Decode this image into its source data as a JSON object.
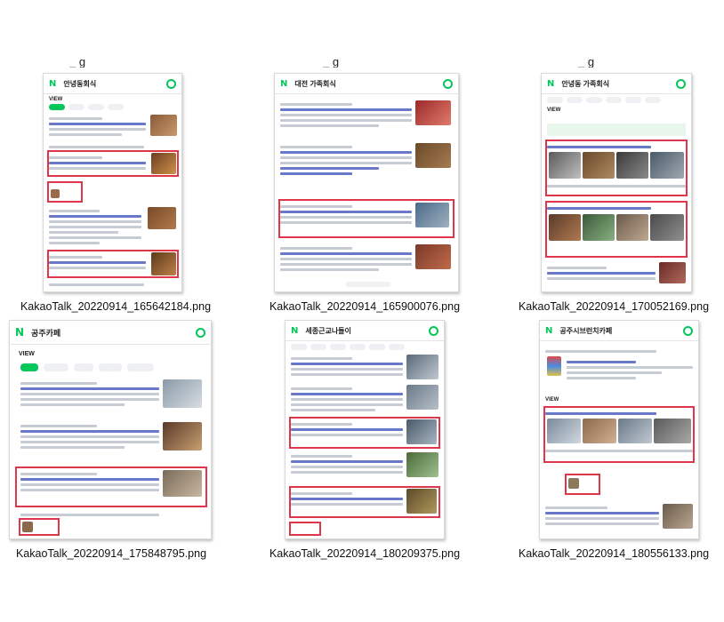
{
  "top_row_cut_text": [
    "_  g",
    "_  g",
    "_  g"
  ],
  "files": [
    {
      "filename": "KakaoTalk_20220914_165642184.png",
      "query": "안녕동회식",
      "view_label": "VIEW"
    },
    {
      "filename": "KakaoTalk_20220914_165900076.png",
      "query": "대전 가족회식",
      "view_label": ""
    },
    {
      "filename": "KakaoTalk_20220914_170052169.png",
      "query": "안녕동 가족회식",
      "view_label": "VIEW"
    },
    {
      "filename": "KakaoTalk_20220914_175848795.png",
      "query": "공주카페",
      "view_label": "VIEW"
    },
    {
      "filename": "KakaoTalk_20220914_180209375.png",
      "query": "세종근교나들이",
      "view_label": ""
    },
    {
      "filename": "KakaoTalk_20220914_180556133.png",
      "query": "공주시브런치카페",
      "view_label": "VIEW"
    }
  ],
  "colors": {
    "naver_green": "#03c75a",
    "highlight_red": "#e0364b",
    "link_blue": "#6a78c9"
  }
}
